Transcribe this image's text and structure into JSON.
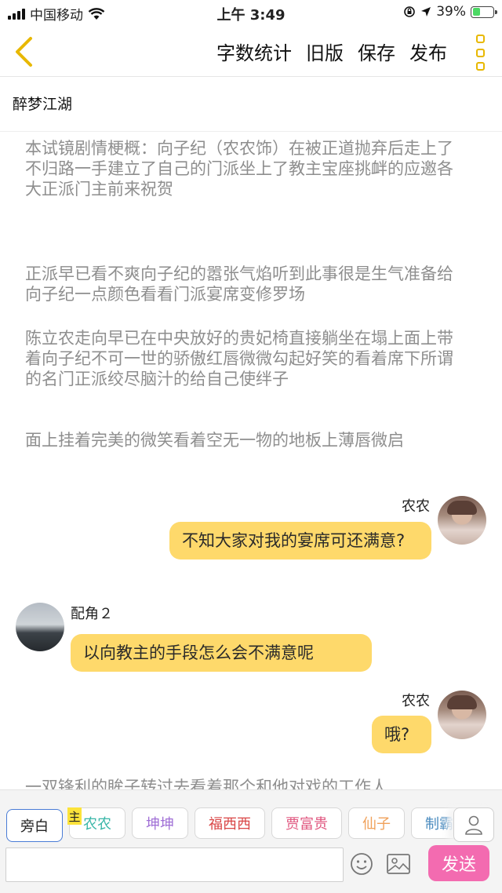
{
  "status_bar": {
    "carrier": "中国移动",
    "time": "上午 3:49",
    "battery": "39%",
    "battery_level": 0.39
  },
  "header": {
    "actions": [
      "字数统计",
      "旧版",
      "保存",
      "发布"
    ]
  },
  "title": "醉梦江湖",
  "narration": [
    "本试镜剧情梗概：向子纪（农农饰）在被正道抛弃后走上了不归路一手建立了自己的门派坐上了教主宝座挑衅的应邀各大正派门主前来祝贺",
    "正派早已看不爽向子纪的嚣张气焰听到此事很是生气准备给向子纪一点颜色看看门派宴席变修罗场",
    "陈立农走向早已在中央放好的贵妃椅直接躺坐在塌上面上带着向子纪不可一世的骄傲红唇微微勾起好笑的看着席下所谓的名门正派绞尽脑汁的给自己使绊子",
    "面上挂着完美的微笑看着空无一物的地板上薄唇微启"
  ],
  "messages": [
    {
      "speaker": "农农",
      "text": "不知大家对我的宴席可还满意?",
      "side": "right"
    },
    {
      "speaker": "配角２",
      "text": "以向教主的手段怎么会不满意呢",
      "side": "left"
    },
    {
      "speaker": "农农",
      "text": "哦?",
      "side": "right"
    }
  ],
  "trailing_narration": "一双锋利的眸子转过去看着那个和他对戏的工作人",
  "roles": [
    {
      "label": "旁白",
      "color": "#222222"
    },
    {
      "label": "农农",
      "color": "#3bb7a9"
    },
    {
      "label": "坤坤",
      "color": "#a06fd6"
    },
    {
      "label": "福西西",
      "color": "#d94545"
    },
    {
      "label": "贾富贵",
      "color": "#e0567f"
    },
    {
      "label": "仙子",
      "color": "#f0a15a"
    },
    {
      "label": "制霸",
      "color": "#4a8bbf"
    }
  ],
  "lead_tag": "主",
  "input": {
    "value": "",
    "placeholder": ""
  },
  "send_label": "发送",
  "accent_color": "#e8b800"
}
